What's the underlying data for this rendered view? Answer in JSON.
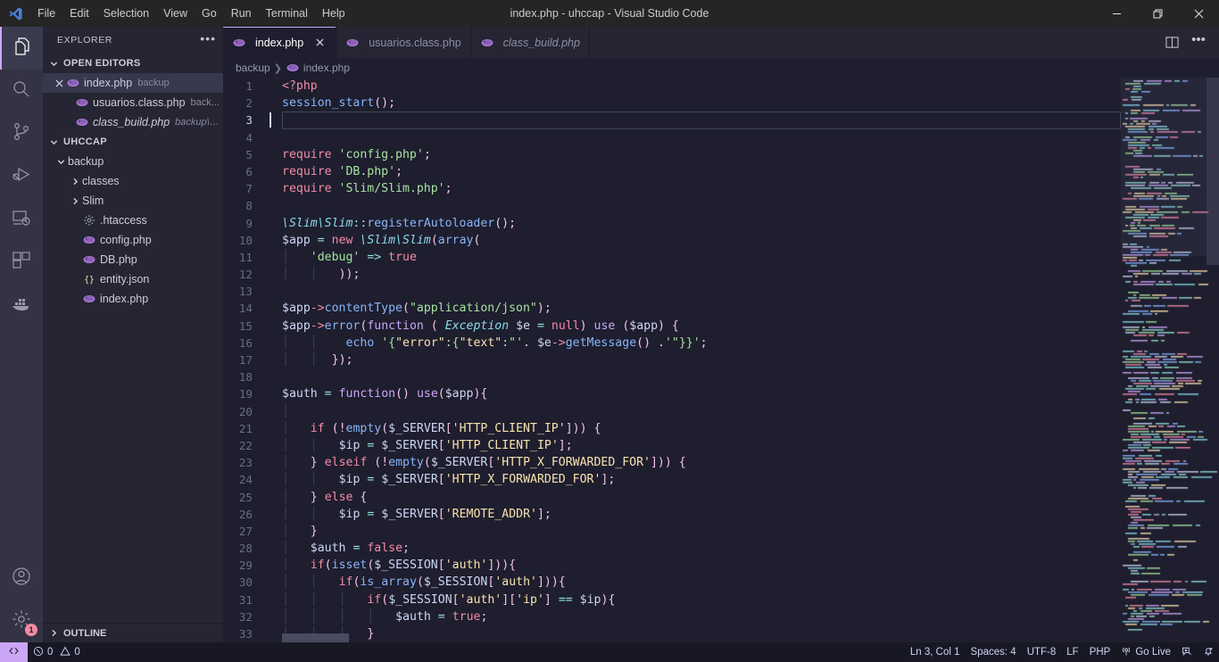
{
  "window": {
    "title": "index.php - uhccap - Visual Studio Code",
    "controls": {
      "minimize": "minimize-icon",
      "restore": "restore-icon",
      "close": "close-icon"
    }
  },
  "menubar": {
    "items": [
      {
        "label": "File"
      },
      {
        "label": "Edit"
      },
      {
        "label": "Selection"
      },
      {
        "label": "View"
      },
      {
        "label": "Go"
      },
      {
        "label": "Run"
      },
      {
        "label": "Terminal"
      },
      {
        "label": "Help"
      }
    ]
  },
  "activitybar": {
    "top": [
      {
        "name": "explorer",
        "icon": "files-icon",
        "active": true
      },
      {
        "name": "search",
        "icon": "search-icon",
        "active": false
      },
      {
        "name": "source-control",
        "icon": "source-control-icon",
        "active": false
      },
      {
        "name": "run-debug",
        "icon": "run-and-debug-icon",
        "active": false
      },
      {
        "name": "remote-explorer",
        "icon": "remote-explorer-icon",
        "active": false
      },
      {
        "name": "extensions",
        "icon": "extensions-icon",
        "active": false
      },
      {
        "name": "docker",
        "icon": "docker-icon",
        "active": false
      }
    ],
    "bottom": [
      {
        "name": "accounts",
        "icon": "account-icon",
        "badge": ""
      },
      {
        "name": "manage-settings",
        "icon": "gear-icon",
        "badge": "1"
      }
    ]
  },
  "sidebar": {
    "header": {
      "title": "EXPLORER",
      "more_actions": "more-actions-icon"
    },
    "open_editors": {
      "label": "OPEN EDITORS",
      "expanded": true,
      "items": [
        {
          "name": "index.php",
          "description": "backup",
          "icon": "php-icon",
          "selected": true,
          "has_close": true,
          "italic": false
        },
        {
          "name": "usuarios.class.php",
          "description": "back...",
          "icon": "php-icon",
          "selected": false,
          "has_close": false,
          "italic": false
        },
        {
          "name": "class_build.php",
          "description": "backup\\c...",
          "icon": "php-icon",
          "selected": false,
          "has_close": false,
          "italic": true
        }
      ]
    },
    "workspace": {
      "label": "UHCCAP",
      "expanded": true,
      "items": [
        {
          "name": "backup",
          "icon": "folder-open-icon",
          "indent": 1,
          "expanded": true,
          "type": "folder"
        },
        {
          "name": "classes",
          "icon": "folder-icon",
          "indent": 2,
          "expanded": false,
          "type": "folder"
        },
        {
          "name": "Slim",
          "icon": "folder-icon",
          "indent": 2,
          "expanded": false,
          "type": "folder"
        },
        {
          "name": ".htaccess",
          "icon": "gear-file-icon",
          "indent": 2,
          "type": "file"
        },
        {
          "name": "config.php",
          "icon": "php-icon",
          "indent": 2,
          "type": "file"
        },
        {
          "name": "DB.php",
          "icon": "php-icon",
          "indent": 2,
          "type": "file"
        },
        {
          "name": "entity.json",
          "icon": "json-icon",
          "indent": 2,
          "type": "file"
        },
        {
          "name": "index.php",
          "icon": "php-icon",
          "indent": 2,
          "type": "file"
        }
      ]
    },
    "outline": {
      "label": "OUTLINE",
      "expanded": false
    }
  },
  "editor": {
    "tabs": [
      {
        "label": "index.php",
        "icon": "php-icon",
        "active": true,
        "italic": false,
        "closable": true
      },
      {
        "label": "usuarios.class.php",
        "icon": "php-icon",
        "active": false,
        "italic": false,
        "closable": false
      },
      {
        "label": "class_build.php",
        "icon": "php-icon",
        "active": false,
        "italic": true,
        "closable": false
      }
    ],
    "tab_actions": [
      {
        "name": "split-editor-right",
        "icon": "split-editor-icon"
      },
      {
        "name": "more-editor-actions",
        "icon": "more-actions-icon"
      }
    ],
    "breadcrumb": [
      {
        "label": "backup",
        "icon": ""
      },
      {
        "label": "index.php",
        "icon": "php-icon"
      }
    ],
    "cursor_line": 3,
    "first_line": 1,
    "lines": [
      {
        "n": 1,
        "html": "<span class=\"kp\">&lt;?php</span>"
      },
      {
        "n": 2,
        "html": "<span class=\"fn\">session_start</span><span class=\"p\">();</span>"
      },
      {
        "n": 3,
        "html": ""
      },
      {
        "n": 4,
        "html": ""
      },
      {
        "n": 5,
        "html": "<span class=\"kp\">require</span> <span class=\"s\">'config.php'</span><span class=\"p\">;</span>"
      },
      {
        "n": 6,
        "html": "<span class=\"kp\">require</span> <span class=\"s\">'DB.php'</span><span class=\"p\">;</span>"
      },
      {
        "n": 7,
        "html": "<span class=\"kp\">require</span> <span class=\"s\">'Slim/Slim.php'</span><span class=\"p\">;</span>"
      },
      {
        "n": 8,
        "html": ""
      },
      {
        "n": 9,
        "html": "<span class=\"cls\">\\Slim\\Slim</span><span class=\"op\">::</span><span class=\"fn\">registerAutoloader</span><span class=\"p\">();</span>"
      },
      {
        "n": 10,
        "html": "<span class=\"v\">$app</span> <span class=\"op\">=</span> <span class=\"kp\">new</span> <span class=\"cls\">\\Slim\\Slim</span><span class=\"p\">(</span><span class=\"fn\">array</span><span class=\"p\">(</span>"
      },
      {
        "n": 11,
        "html": "<span class=\"indent\">│</span>   <span class=\"s\">'debug'</span> <span class=\"op\">=&gt;</span> <span class=\"kp\">true</span>"
      },
      {
        "n": 12,
        "html": "<span class=\"indent\">│</span>   <span class=\"indent\">│</span>   <span class=\"p\">));</span>"
      },
      {
        "n": 13,
        "html": ""
      },
      {
        "n": 14,
        "html": "<span class=\"v\">$app</span><span class=\"kp\">-&gt;</span><span class=\"fn\">contentType</span><span class=\"p\">(</span><span class=\"s\">\"application/json\"</span><span class=\"p\">);</span>"
      },
      {
        "n": 15,
        "html": "<span class=\"v\">$app</span><span class=\"kp\">-&gt;</span><span class=\"fn\">error</span><span class=\"p\">(</span><span class=\"k\">function</span> <span class=\"p\">(</span> <span class=\"cls\">Exception</span> <span class=\"v\">$e</span> <span class=\"op\">=</span> <span class=\"kp\">null</span><span class=\"p\">)</span> <span class=\"k\">use</span> <span class=\"p\">(</span><span class=\"v\">$app</span><span class=\"p\">) {</span>"
      },
      {
        "n": 16,
        "html": "<span class=\"indent\">│</span>   <span class=\"indent\">│</span>    <span class=\"fn\">echo</span> <span class=\"s\">'{</span><span class=\"str-y\">\"error\"</span><span class=\"s\">:{</span><span class=\"str-y\">\"text\"</span><span class=\"s\">:\"'</span><span class=\"p\">.</span> <span class=\"v\">$e</span><span class=\"kp\">-&gt;</span><span class=\"fn\">getMessage</span><span class=\"p\">()</span> <span class=\"p\">.</span><span class=\"s\">'\"}}'</span><span class=\"p\">;</span>"
      },
      {
        "n": 17,
        "html": "<span class=\"indent\">│</span>   <span class=\"indent\">│</span>  <span class=\"p\">});</span>"
      },
      {
        "n": 18,
        "html": ""
      },
      {
        "n": 19,
        "html": "<span class=\"v\">$auth</span> <span class=\"op\">=</span> <span class=\"k\">function</span><span class=\"p\">()</span> <span class=\"k\">use</span><span class=\"p\">(</span><span class=\"v\">$app</span><span class=\"p\">){</span>"
      },
      {
        "n": 20,
        "html": "<span class=\"indent\">│</span>"
      },
      {
        "n": 21,
        "html": "<span class=\"indent\">│</span>   <span class=\"kp\">if</span> <span class=\"p\">(!</span><span class=\"fn\">empty</span><span class=\"p\">(</span><span class=\"v\">$_SERVER</span><span class=\"p\">[</span><span class=\"str-y\">'HTTP_CLIENT_IP'</span><span class=\"p\">])) {</span>"
      },
      {
        "n": 22,
        "html": "<span class=\"indent\">│</span>   <span class=\"indent\">│</span>   <span class=\"v\">$ip</span> <span class=\"op\">=</span> <span class=\"v\">$_SERVER</span><span class=\"p\">[</span><span class=\"str-y\">'HTTP_CLIENT_IP'</span><span class=\"p\">];</span>"
      },
      {
        "n": 23,
        "html": "<span class=\"indent\">│</span>   <span class=\"p\">}</span> <span class=\"kp\">elseif</span> <span class=\"p\">(!</span><span class=\"fn\">empty</span><span class=\"p\">(</span><span class=\"v\">$_SERVER</span><span class=\"p\">[</span><span class=\"str-y\">'HTTP_X_FORWARDED_FOR'</span><span class=\"p\">])) {</span>"
      },
      {
        "n": 24,
        "html": "<span class=\"indent\">│</span>   <span class=\"indent\">│</span>   <span class=\"v\">$ip</span> <span class=\"op\">=</span> <span class=\"v\">$_SERVER</span><span class=\"p\">[</span><span class=\"str-y\">'HTTP_X_FORWARDED_FOR'</span><span class=\"p\">];</span>"
      },
      {
        "n": 25,
        "html": "<span class=\"indent\">│</span>   <span class=\"p\">}</span> <span class=\"kp\">else</span> <span class=\"p\">{</span>"
      },
      {
        "n": 26,
        "html": "<span class=\"indent\">│</span>   <span class=\"indent\">│</span>   <span class=\"v\">$ip</span> <span class=\"op\">=</span> <span class=\"v\">$_SERVER</span><span class=\"p\">[</span><span class=\"str-y\">'REMOTE_ADDR'</span><span class=\"p\">];</span>"
      },
      {
        "n": 27,
        "html": "<span class=\"indent\">│</span>   <span class=\"p\">}</span>"
      },
      {
        "n": 28,
        "html": "<span class=\"indent\">│</span>   <span class=\"v\">$auth</span> <span class=\"op\">=</span> <span class=\"kp\">false</span><span class=\"p\">;</span>"
      },
      {
        "n": 29,
        "html": "<span class=\"indent\">│</span>   <span class=\"kp\">if</span><span class=\"p\">(</span><span class=\"fn\">isset</span><span class=\"p\">(</span><span class=\"v\">$_SESSION</span><span class=\"p\">[</span><span class=\"str-y\">'auth'</span><span class=\"p\">])){</span>"
      },
      {
        "n": 30,
        "html": "<span class=\"indent\">│</span>   <span class=\"indent\">│</span>   <span class=\"kp\">if</span><span class=\"p\">(</span><span class=\"fn\">is_array</span><span class=\"p\">(</span><span class=\"v\">$_SESSION</span><span class=\"p\">[</span><span class=\"str-y\">'auth'</span><span class=\"p\">])){</span>"
      },
      {
        "n": 31,
        "html": "<span class=\"indent\">│</span>   <span class=\"indent\">│</span>   <span class=\"indent\">│</span>   <span class=\"kp\">if</span><span class=\"p\">(</span><span class=\"v\">$_SESSION</span><span class=\"p\">[</span><span class=\"str-y\">'auth'</span><span class=\"p\">][</span><span class=\"str-y\">'ip'</span><span class=\"p\">]</span> <span class=\"op\">==</span> <span class=\"v\">$ip</span><span class=\"p\">){</span>"
      },
      {
        "n": 32,
        "html": "<span class=\"indent\">│</span>   <span class=\"indent\">│</span>   <span class=\"indent\">│</span>   <span class=\"indent\">│</span>   <span class=\"v\">$auth</span> <span class=\"op\">=</span> <span class=\"kp\">true</span><span class=\"p\">;</span>"
      },
      {
        "n": 33,
        "html": "<span class=\"indent\">│</span>   <span class=\"indent\">│</span>   <span class=\"indent\">│</span>   <span class=\"p\">}</span>"
      }
    ]
  },
  "statusbar": {
    "remote": {
      "label": "",
      "icon": "remote-window-icon"
    },
    "left": [
      {
        "name": "problems",
        "errors": "0",
        "warnings": "0",
        "error_icon": "error-icon",
        "warning_icon": "warning-icon"
      }
    ],
    "right": [
      {
        "name": "editor-position",
        "label": "Ln 3, Col 1"
      },
      {
        "name": "editor-indentation",
        "label": "Spaces: 4"
      },
      {
        "name": "editor-encoding",
        "label": "UTF-8"
      },
      {
        "name": "editor-eol",
        "label": "LF"
      },
      {
        "name": "editor-language",
        "label": "PHP"
      },
      {
        "name": "go-live",
        "label": "Go Live",
        "icon": "broadcast-icon"
      },
      {
        "name": "feedback",
        "label": "",
        "icon": "feedback-smiley-icon"
      },
      {
        "name": "notifications",
        "label": "",
        "icon": "bell-dot-icon"
      }
    ]
  },
  "colors": {
    "accent": "#cba6f7",
    "editor_bg": "#1e1e2e",
    "sidebar_bg": "#252533",
    "activitybar_bg": "#333344",
    "statusbar_bg": "#181825",
    "badge_bg": "#f38ba8",
    "string": "#a6e3a1",
    "keyword": "#cba6f7",
    "keyword_pink": "#f38ba8",
    "function": "#89b4fa",
    "class": "#89dceb",
    "yellow_string": "#f9e2af"
  }
}
